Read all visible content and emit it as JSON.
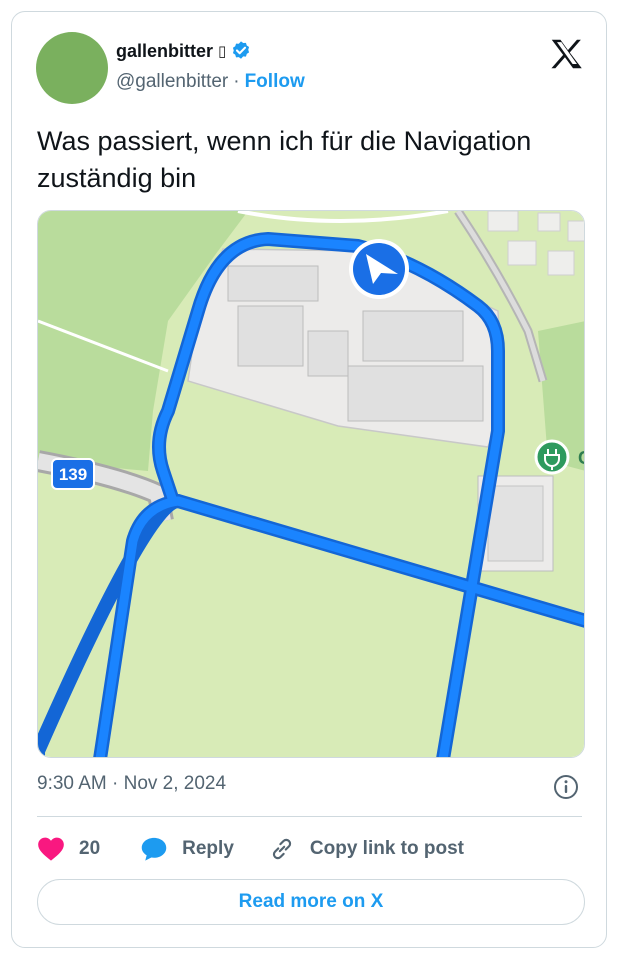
{
  "user": {
    "display_name": "gallenbitter",
    "name_glyph": "▯",
    "handle": "@gallenbitter",
    "separator": "·",
    "follow_label": "Follow"
  },
  "tweet": {
    "text": "Was passiert, wenn ich für die Navigation zuständig bin"
  },
  "media": {
    "road_number": "139",
    "poi_letter": "G"
  },
  "meta": {
    "timestamp": "9:30 AM · Nov 2, 2024"
  },
  "actions": {
    "likes_count": "20",
    "reply_label": "Reply",
    "copy_label": "Copy link to post"
  },
  "footer": {
    "read_more_label": "Read more on X"
  },
  "colors": {
    "accent": "#1d9bf0",
    "like": "#f91880",
    "route": "#1a84ff",
    "map_green": "#d8ebb7",
    "map_grass": "#b9dc9c",
    "building": "#eeeeec"
  },
  "icons": [
    "verified-badge-icon",
    "x-logo-icon",
    "navigation-arrow-icon",
    "ev-charging-icon",
    "info-icon",
    "heart-icon",
    "reply-bubble-icon",
    "link-icon"
  ]
}
